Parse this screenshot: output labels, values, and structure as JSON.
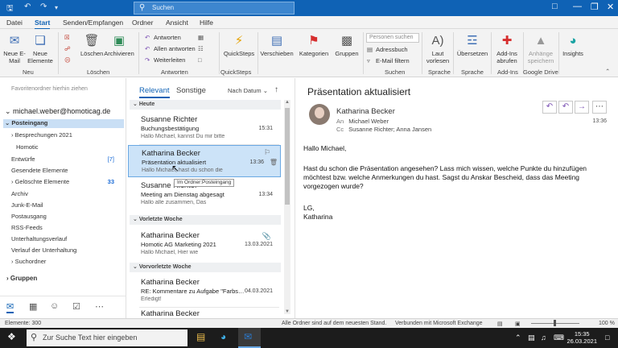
{
  "titlebar": {
    "search_placeholder": "Suchen"
  },
  "menu": [
    "Datei",
    "Start",
    "Senden/Empfangen",
    "Ordner",
    "Ansicht",
    "Hilfe"
  ],
  "ribbon": {
    "new_email": "Neue E-Mail",
    "new_items": "Neue Elemente",
    "group_new": "Neu",
    "delete": "Löschen",
    "archive": "Archivieren",
    "group_delete": "Löschen",
    "reply": "Antworten",
    "reply_all": "Allen antworten",
    "forward": "Weiterleiten",
    "group_respond": "Antworten",
    "quicksteps": "QuickSteps",
    "group_quicksteps": "QuickSteps",
    "move": "Verschieben",
    "categories": "Kategorien",
    "groups": "Gruppen",
    "people_search": "Personen suchen",
    "address_book": "Adressbuch",
    "filter_email": "E-Mail filtern",
    "group_search": "Suchen",
    "read_aloud": "Laut vorlesen",
    "group_speech": "Sprache",
    "translate": "Übersetzen",
    "group_language": "Sprache",
    "get_addins": "Add-Ins abrufen",
    "group_addins": "Add-Ins",
    "save_attachments": "Anhänge speichern",
    "group_gdrive": "Google Drive",
    "insights": "Insights"
  },
  "nav": {
    "favorites_hint": "Favoritenordner hierhin ziehen",
    "account": "michael.weber@homoticag.de",
    "folders": [
      {
        "label": "Posteingang",
        "count": ""
      },
      {
        "label": "Besprechungen 2021",
        "count": ""
      },
      {
        "label": "Homotic",
        "count": ""
      },
      {
        "label": "Entwürfe",
        "count": "[7]"
      },
      {
        "label": "Gesendete Elemente",
        "count": ""
      },
      {
        "label": "Gelöschte Elemente",
        "count": "33"
      },
      {
        "label": "Archiv",
        "count": ""
      },
      {
        "label": "Junk-E-Mail",
        "count": ""
      },
      {
        "label": "Postausgang",
        "count": ""
      },
      {
        "label": "RSS-Feeds",
        "count": ""
      },
      {
        "label": "Unterhaltungsverlauf",
        "count": ""
      },
      {
        "label": "Verlauf der Unterhaltung",
        "count": ""
      },
      {
        "label": "Suchordner",
        "count": ""
      }
    ],
    "groups": "Gruppen"
  },
  "list": {
    "tab_relevant": "Relevant",
    "tab_other": "Sonstige",
    "sort_label": "Nach Datum",
    "group_today": "Heute",
    "group_lastweek": "Vorletzte Woche",
    "group_weekbefore": "Vorvorletzte Woche",
    "messages": [
      {
        "from": "Susanne Richter",
        "subject": "Buchungsbestätigung",
        "preview": "Hallo Michael,  kannst Du mir bitte",
        "date": "15:31"
      },
      {
        "from": "Katharina Becker",
        "subject": "Präsentation aktualisiert",
        "preview": "Hallo Michael,  hast du schon die",
        "date": "13:36"
      },
      {
        "from": "Susanne Richter",
        "subject": "Meeting am Dienstag abgesagt",
        "preview": "Hallo alle zusammen,  Das",
        "date": "13:34"
      },
      {
        "from": "Katharina Becker",
        "subject": "Homotic AG Marketing 2021",
        "preview": "Hallo Michael,  Hier wie",
        "date": "13.03.2021"
      },
      {
        "from": "Katharina Becker",
        "subject": "RE: Kommentare zu Aufgabe \"Farbs…",
        "preview": "Erledigt!",
        "date": "04.03.2021"
      },
      {
        "from": "Katharina Becker",
        "subject": "",
        "preview": "",
        "date": ""
      }
    ],
    "tooltip": "Im Ordner:Posteingang"
  },
  "reading": {
    "subject": "Präsentation aktualisiert",
    "from": "Katharina Becker",
    "to_label": "An",
    "to": "Michael Weber",
    "cc_label": "Cc",
    "cc": "Susanne Richter; Anna Jansen",
    "time": "13:36",
    "body": [
      "Hallo Michael,",
      "Hast du schon die Präsentation angesehen? Lass mich wissen, welche Punkte du hinzufügen möchtest bzw. welche Anmerkungen du hast. Sagst du Anskar Bescheid, dass das Meeting vorgezogen wurde?",
      "LG,",
      "Katharina"
    ]
  },
  "status": {
    "items": "Elemente: 300",
    "uptodate": "Alle Ordner sind auf dem neuesten Stand.",
    "connected": "Verbunden mit Microsoft Exchange",
    "zoom": "100 %"
  },
  "taskbar": {
    "search_placeholder": "Zur Suche Text hier eingeben",
    "time": "15:35",
    "date": "26.03.2021"
  }
}
